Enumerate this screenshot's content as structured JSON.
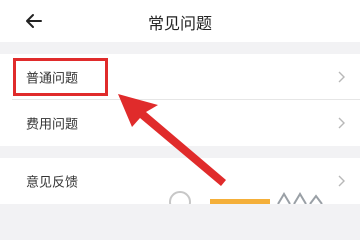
{
  "header": {
    "title": "常见问题"
  },
  "faq": {
    "items": [
      {
        "label": "普通问题"
      },
      {
        "label": "费用问题"
      }
    ]
  },
  "feedback": {
    "label": "意见反馈"
  },
  "annotation": {
    "color": "#e02b2b"
  },
  "icons": {
    "back": "arrow-left-icon",
    "chevron": "chevron-right-icon"
  }
}
